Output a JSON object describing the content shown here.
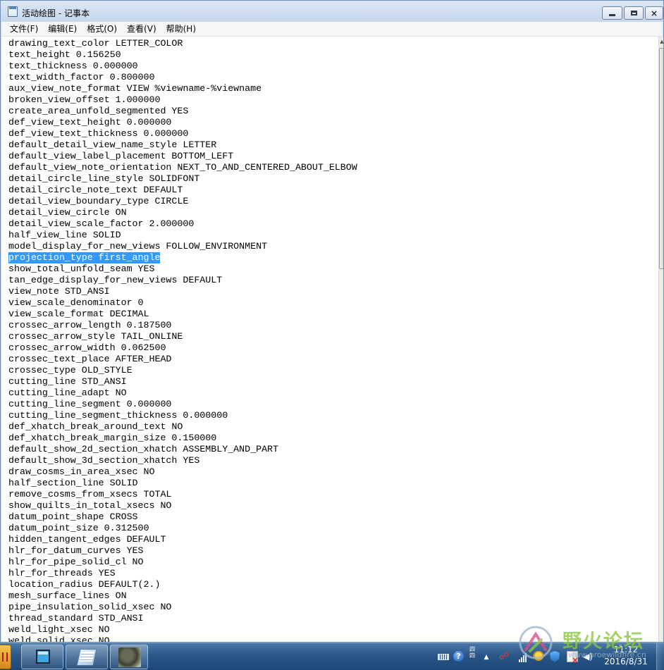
{
  "window": {
    "title": "活动绘图 - 记事本"
  },
  "menu": [
    "文件(F)",
    "编辑(E)",
    "格式(O)",
    "查看(V)",
    "帮助(H)"
  ],
  "editor": {
    "selected_line_index": 19,
    "lines": [
      "drawing_text_color LETTER_COLOR",
      "text_height 0.156250",
      "text_thickness 0.000000",
      "text_width_factor 0.800000",
      "aux_view_note_format VIEW %viewname-%viewname",
      "broken_view_offset 1.000000",
      "create_area_unfold_segmented YES",
      "def_view_text_height 0.000000",
      "def_view_text_thickness 0.000000",
      "default_detail_view_name_style LETTER",
      "default_view_label_placement BOTTOM_LEFT",
      "default_view_note_orientation NEXT_TO_AND_CENTERED_ABOUT_ELBOW",
      "detail_circle_line_style SOLIDFONT",
      "detail_circle_note_text DEFAULT",
      "detail_view_boundary_type CIRCLE",
      "detail_view_circle ON",
      "detail_view_scale_factor 2.000000",
      "half_view_line SOLID",
      "model_display_for_new_views FOLLOW_ENVIRONMENT",
      "projection_type first_angle",
      "show_total_unfold_seam YES",
      "tan_edge_display_for_new_views DEFAULT",
      "view_note STD_ANSI",
      "view_scale_denominator 0",
      "view_scale_format DECIMAL",
      "crossec_arrow_length 0.187500",
      "crossec_arrow_style TAIL_ONLINE",
      "crossec_arrow_width 0.062500",
      "crossec_text_place AFTER_HEAD",
      "crossec_type OLD_STYLE",
      "cutting_line STD_ANSI",
      "cutting_line_adapt NO",
      "cutting_line_segment 0.000000",
      "cutting_line_segment_thickness 0.000000",
      "def_xhatch_break_around_text NO",
      "def_xhatch_break_margin_size 0.150000",
      "default_show_2d_section_xhatch ASSEMBLY_AND_PART",
      "default_show_3d_section_xhatch YES",
      "draw_cosms_in_area_xsec NO",
      "half_section_line SOLID",
      "remove_cosms_from_xsecs TOTAL",
      "show_quilts_in_total_xsecs NO",
      "datum_point_shape CROSS",
      "datum_point_size 0.312500",
      "hidden_tangent_edges DEFAULT",
      "hlr_for_datum_curves YES",
      "hlr_for_pipe_solid_cl NO",
      "hlr_for_threads YES",
      "location_radius DEFAULT(2.)",
      "mesh_surface_lines ON",
      "pipe_insulation_solid_xsec NO",
      "thread_standard STD_ANSI",
      "weld_light_xsec NO",
      "weld_solid_xsec NO"
    ]
  },
  "taskbar": {
    "clock_time": "11:12",
    "clock_date": "2016/8/31",
    "tray_help_label": "?",
    "tray_layout_label": "四\n四",
    "tray_arrow_label": "▲",
    "tray_speaker_label": "◀)"
  },
  "watermark": {
    "name": "野火论坛",
    "site": "www.proewildfire.cn"
  },
  "colors": {
    "selection": "#3399ff",
    "taskbar": "#2a5788",
    "watermark_green": "#8cc63f"
  }
}
